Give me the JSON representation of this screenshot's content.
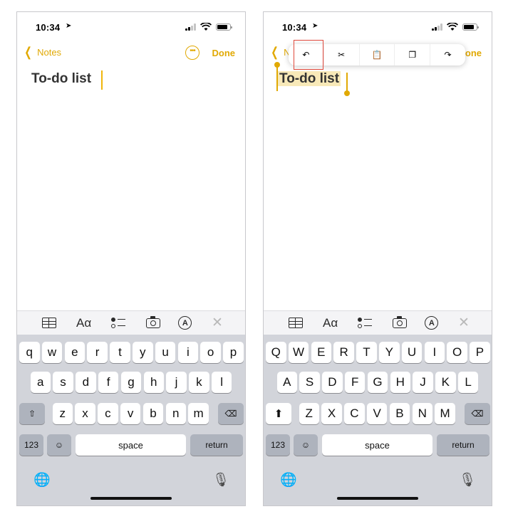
{
  "status": {
    "time": "10:34"
  },
  "accent_color": "#e1a904",
  "left": {
    "nav": {
      "back_label": "Notes",
      "more_icon": "ellipsis-circle-icon",
      "done_label": "Done"
    },
    "note_title": "To-do list"
  },
  "right": {
    "nav": {
      "back_label_visible": "N",
      "done_label_visible": "one"
    },
    "note_title": "To-do list",
    "edit_menu": {
      "items": [
        {
          "icon": "undo-icon",
          "glyph": "↶"
        },
        {
          "icon": "cut-icon",
          "glyph": "✂"
        },
        {
          "icon": "paste-icon",
          "glyph": "📋"
        },
        {
          "icon": "copy-icon",
          "glyph": "❐"
        },
        {
          "icon": "redo-icon",
          "glyph": "↷"
        }
      ],
      "highlighted": "undo-icon"
    }
  },
  "toolbar": {
    "items": [
      "table-icon",
      "text-format-icon",
      "checklist-icon",
      "camera-icon",
      "markup-icon",
      "close-icon"
    ],
    "text_format_label": "Aα",
    "markup_label": "A",
    "close_label": "✕"
  },
  "keyboard_left": {
    "row1": [
      "q",
      "w",
      "e",
      "r",
      "t",
      "y",
      "u",
      "i",
      "o",
      "p"
    ],
    "row2": [
      "a",
      "s",
      "d",
      "f",
      "g",
      "h",
      "j",
      "k",
      "l"
    ],
    "row3": [
      "z",
      "x",
      "c",
      "v",
      "b",
      "n",
      "m"
    ]
  },
  "keyboard_right": {
    "row1": [
      "Q",
      "W",
      "E",
      "R",
      "T",
      "Y",
      "U",
      "I",
      "O",
      "P"
    ],
    "row2": [
      "A",
      "S",
      "D",
      "F",
      "G",
      "H",
      "J",
      "K",
      "L"
    ],
    "row3": [
      "Z",
      "X",
      "C",
      "V",
      "B",
      "N",
      "M"
    ]
  },
  "keyboard_common": {
    "numbers_label": "123",
    "emoji_glyph": "☺",
    "space_label": "space",
    "return_label": "return",
    "shift_left_glyph": "⇧",
    "shift_right_glyph": "⬆",
    "delete_glyph": "⌫",
    "globe_glyph": "🌐",
    "mic_glyph": "🎙"
  }
}
